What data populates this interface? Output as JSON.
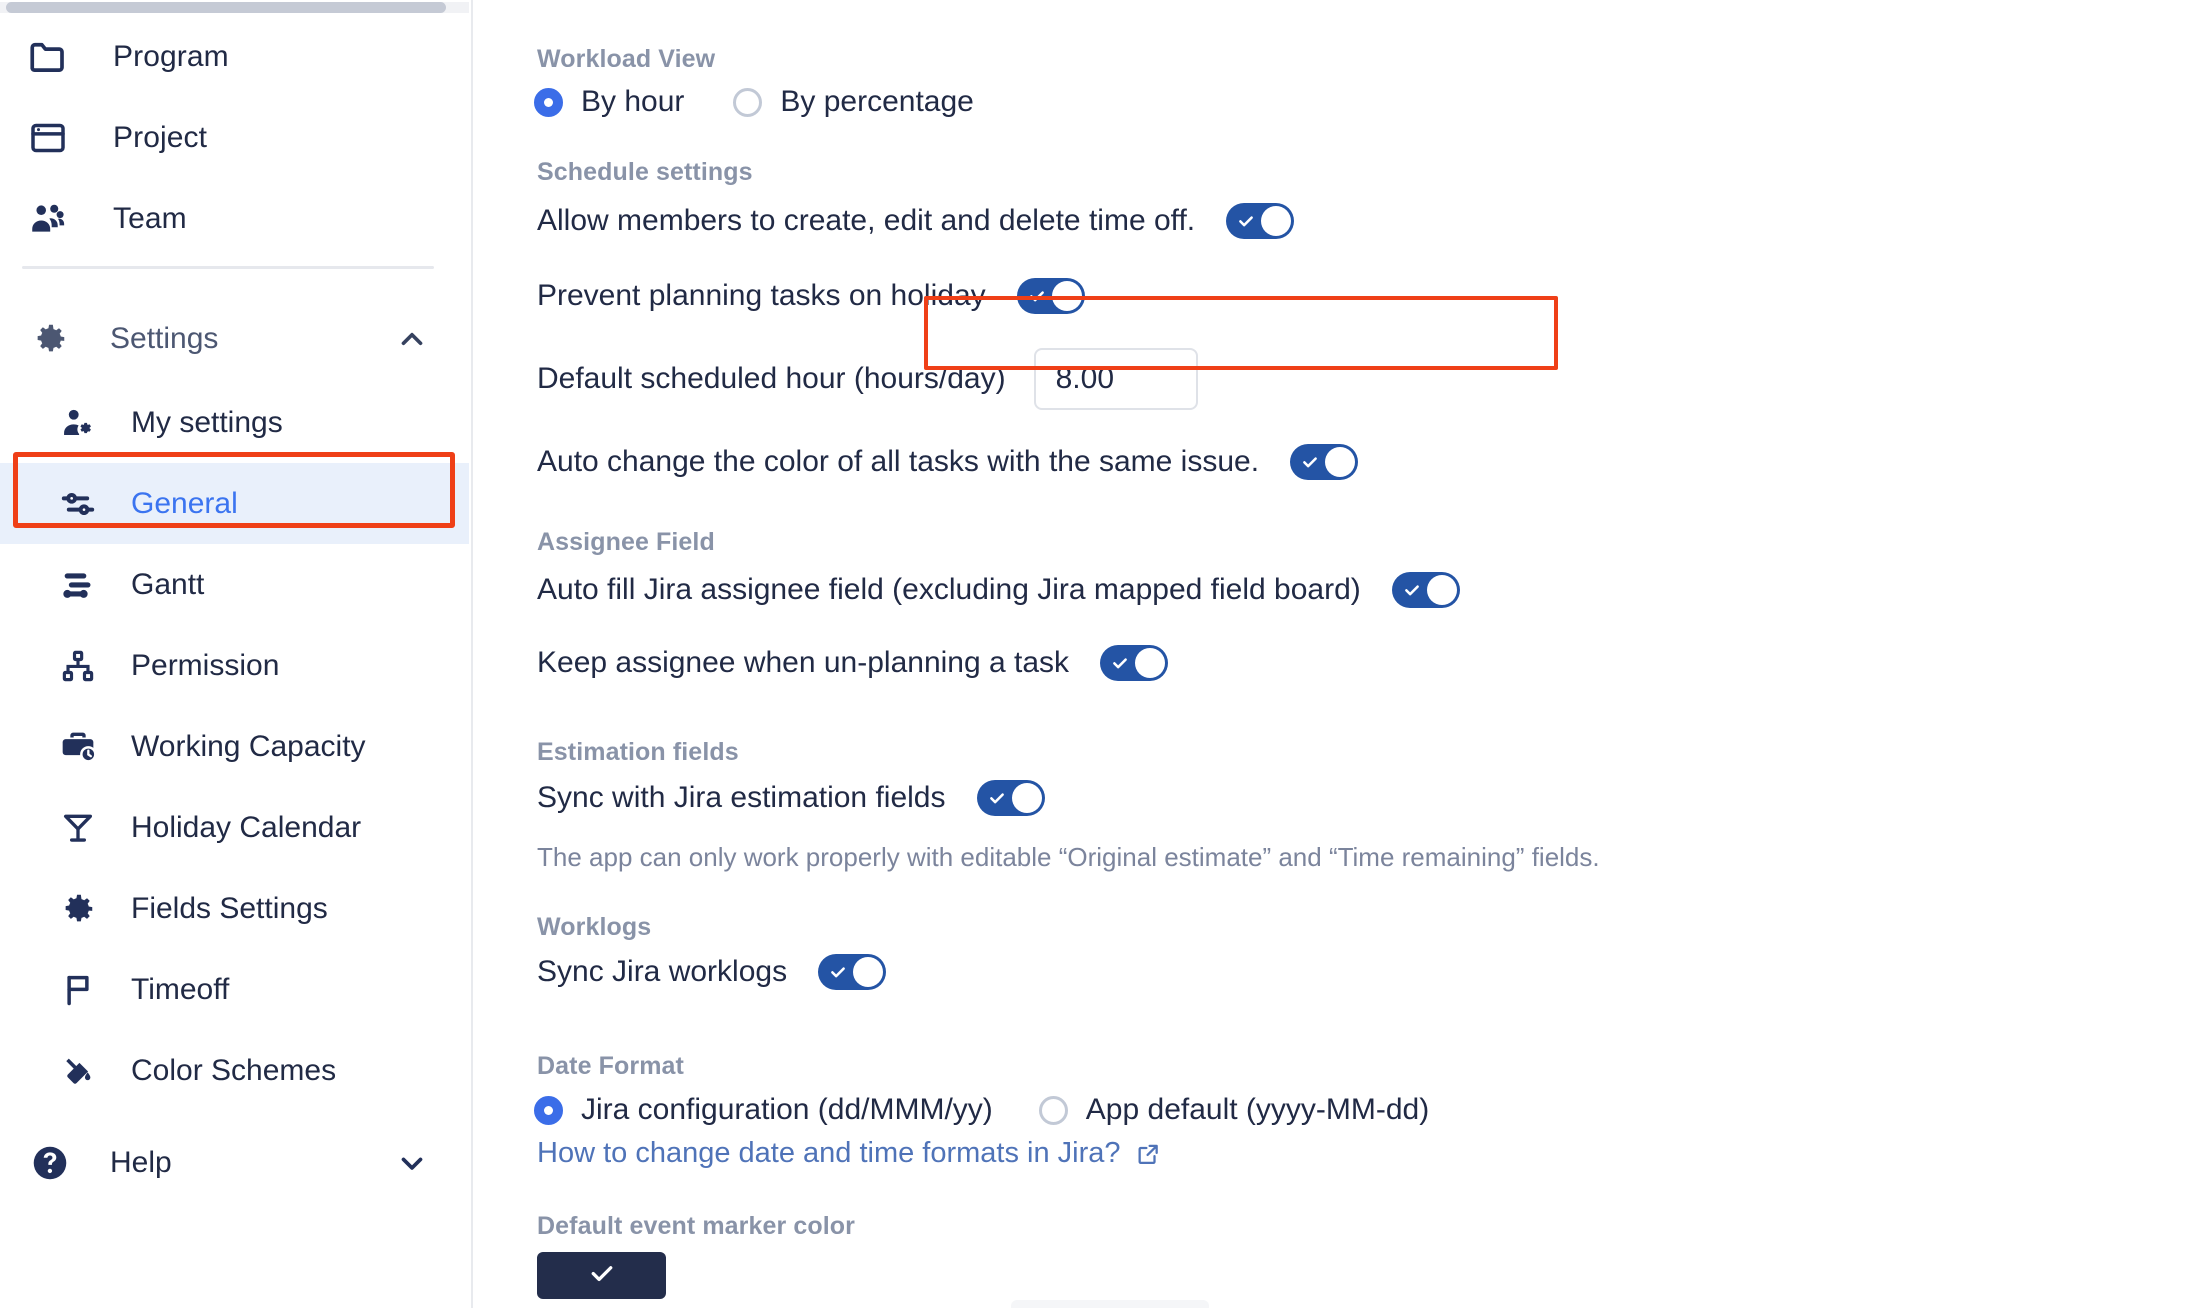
{
  "sidebar": {
    "top_items": [
      {
        "label": "Program",
        "icon": "folder-icon"
      },
      {
        "label": "Project",
        "icon": "browser-window-icon"
      },
      {
        "label": "Team",
        "icon": "people-group-icon"
      }
    ],
    "settings": {
      "label": "Settings",
      "icon": "gear-icon",
      "chevron": "chevron-up-icon"
    },
    "sub_items": [
      {
        "label": "My settings",
        "icon": "user-gear-icon",
        "active": false
      },
      {
        "label": "General",
        "icon": "sliders-icon",
        "active": true
      },
      {
        "label": "Gantt",
        "icon": "gantt-bars-icon",
        "active": false
      },
      {
        "label": "Permission",
        "icon": "hierarchy-icon",
        "active": false
      },
      {
        "label": "Working Capacity",
        "icon": "briefcase-clock-icon",
        "active": false
      },
      {
        "label": "Holiday Calendar",
        "icon": "cocktail-glass-icon",
        "active": false
      },
      {
        "label": "Fields Settings",
        "icon": "gear-icon",
        "active": false
      },
      {
        "label": "Timeoff",
        "icon": "flag-icon",
        "active": false
      },
      {
        "label": "Color Schemes",
        "icon": "paint-bucket-icon",
        "active": false
      }
    ],
    "help": {
      "label": "Help",
      "icon": "question-circle-icon",
      "chevron": "chevron-down-icon"
    }
  },
  "main": {
    "workload_view": {
      "heading": "Workload View",
      "options": [
        {
          "label": "By hour",
          "selected": true
        },
        {
          "label": "By percentage",
          "selected": false
        }
      ]
    },
    "schedule_settings": {
      "heading": "Schedule settings",
      "allow_timeoff_label": "Allow members to create, edit and delete time off.",
      "allow_timeoff_state": "on",
      "prevent_holiday_label": "Prevent planning tasks on holiday",
      "prevent_holiday_state": "on",
      "default_hour_label": "Default scheduled hour (hours/day)",
      "default_hour_value": "8.00",
      "auto_color_label": "Auto change the color of all tasks with the same issue.",
      "auto_color_state": "on"
    },
    "assignee_field": {
      "heading": "Assignee Field",
      "auto_fill_label": "Auto fill Jira assignee field (excluding Jira mapped field board)",
      "auto_fill_state": "on",
      "keep_assignee_label": "Keep assignee when un-planning a task",
      "keep_assignee_state": "on"
    },
    "estimation_fields": {
      "heading": "Estimation fields",
      "sync_label": "Sync with Jira estimation fields",
      "sync_state": "on",
      "note": "The app can only work properly with editable “Original estimate” and “Time remaining” fields."
    },
    "worklogs": {
      "heading": "Worklogs",
      "sync_label": "Sync Jira worklogs",
      "sync_state": "on"
    },
    "date_format": {
      "heading": "Date Format",
      "options": [
        {
          "label": "Jira configuration (dd/MMM/yy)",
          "selected": true
        },
        {
          "label": "App default (yyyy-MM-dd)",
          "selected": false
        }
      ],
      "help_link": "How to change date and time formats in Jira?",
      "help_link_icon": "external-link-icon"
    },
    "event_marker": {
      "heading": "Default event marker color",
      "color": "#232d4b",
      "check_icon": "check-icon"
    }
  },
  "colors": {
    "toggle_on": "#2454a5",
    "radio_on": "#3b6de8",
    "accent_link": "#3b74f0",
    "highlight_box": "#ef3f17",
    "active_row_bg": "#e9f0fb",
    "event_marker": "#232d4b"
  }
}
